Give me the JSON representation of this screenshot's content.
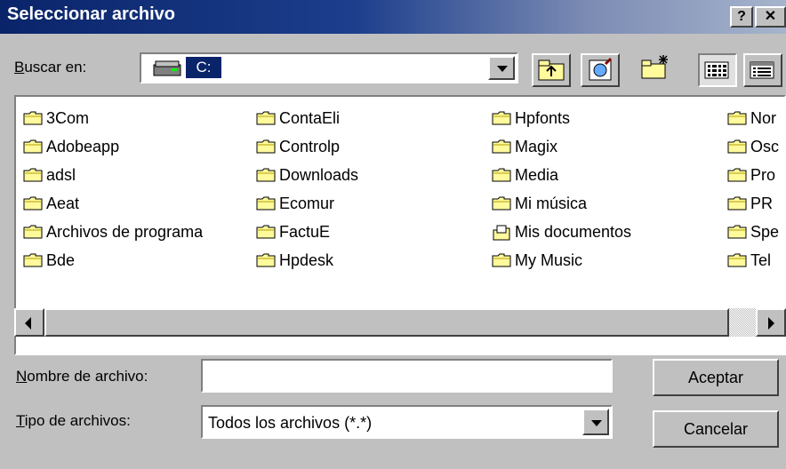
{
  "window": {
    "title": "Seleccionar archivo",
    "help_label": "?",
    "close_label": "✕"
  },
  "lookin": {
    "label_u": "B",
    "label_rest": "uscar en:",
    "value": "(C:)",
    "drive_label": "C:"
  },
  "toolbar": {
    "icons": [
      "up-one-level-icon",
      "search-web-icon",
      "create-new-folder-icon",
      "list-view-icon",
      "details-view-icon"
    ]
  },
  "files": {
    "col1": [
      "3Com",
      "Adobeapp",
      "adsl",
      "Aeat",
      "Archivos de programa",
      "Bde"
    ],
    "col2": [
      "ContaEli",
      "Controlp",
      "Downloads",
      "Ecomur",
      "FactuE",
      "Hpdesk"
    ],
    "col3": [
      "Hpfonts",
      "Magix",
      "Media",
      "Mi música",
      "Mis documentos",
      "My Music"
    ],
    "col4": [
      "Nor",
      "Osc",
      "Pro",
      "PR",
      "Spe",
      "Tel"
    ]
  },
  "filename": {
    "label_u": "N",
    "label_rest": "ombre de archivo:",
    "value": ""
  },
  "filetype": {
    "label_u": "T",
    "label_rest": "ipo de archivos:",
    "value": "Todos los archivos (*.*)"
  },
  "buttons": {
    "accept": "Aceptar",
    "cancel": "Cancelar"
  },
  "colors": {
    "titlebar": "#0a246a",
    "face": "#c0c0c0",
    "folder": "#fffa9c"
  }
}
